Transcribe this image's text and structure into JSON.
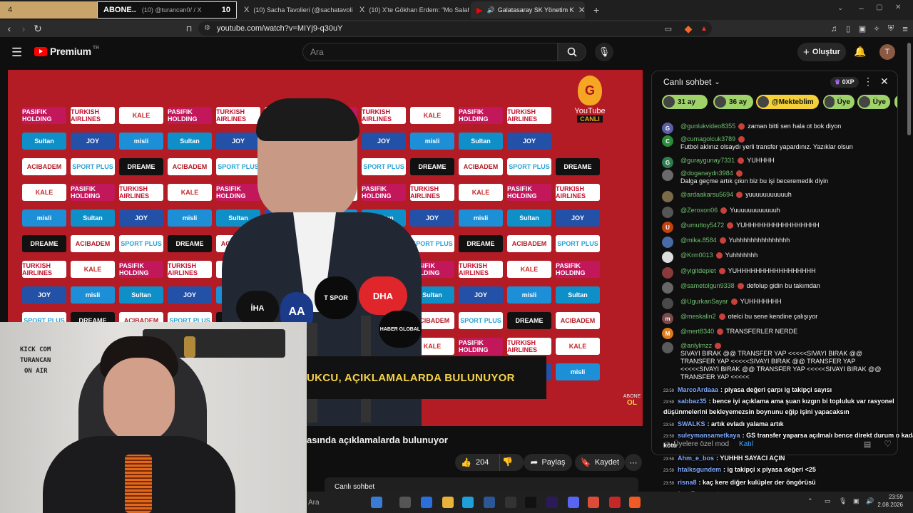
{
  "browser": {
    "tabs": [
      {
        "favicon": "4",
        "title": "ABONE.."
      },
      {
        "favicon": "",
        "title": "(10) @turancan0/ / X",
        "badge": "10"
      },
      {
        "favicon": "X",
        "title": "(10) Sacha Tavolieri (@sachatavolieri)"
      },
      {
        "favicon": "X",
        "title": "(10) X'te Gökhan Erdem: \"Mo Salah ("
      },
      {
        "favicon": "▶",
        "title": "Galatasaray SK Yönetim K"
      }
    ],
    "url": "youtube.com/watch?v=MIYj9-q30uY"
  },
  "youtube": {
    "logo_text": "Premium",
    "logo_sup": "TR",
    "search_placeholder": "Ara",
    "create_label": "Oluştur",
    "avatar_letter": "T"
  },
  "video": {
    "sponsors": [
      "PASIFIK HOLDING",
      "ACIBADEM",
      "misli",
      "TURKISH AIRLINES",
      "SPORT PLUS",
      "Sultan",
      "KALE",
      "DREAME",
      "JOY"
    ],
    "lower_third": "UKCU, AÇIKLAMALARDA BULUNUYOR",
    "channel_badge_line1": "YouTube",
    "channel_badge_line2": "CANLI",
    "corner_badge_line1": "ABONE",
    "corner_badge_line2": "OL",
    "mic_labels": [
      "İHA",
      "AA",
      "T SPOR",
      "DHA",
      "HABER GLOBAL",
      "SPOR"
    ]
  },
  "webcam": {
    "sign_lines": [
      "KICK COM",
      "TURANCAN",
      "ON AIR"
    ]
  },
  "below_video": {
    "title": "asında açıklamalarda bulunuyor",
    "like_count": "204",
    "share_label": "Paylaş",
    "save_label": "Kaydet",
    "live_chat_label": "Canlı sohbet"
  },
  "chat": {
    "title": "Canlı sohbet",
    "points": "0XP",
    "pills": [
      {
        "label": "31 ay",
        "color": "#9fd36a"
      },
      {
        "label": "36 ay",
        "color": "#9fd36a"
      },
      {
        "label": "@Mekteblim",
        "color": "#f4d13a"
      },
      {
        "label": "Üye",
        "color": "#9fd36a"
      },
      {
        "label": "Üye",
        "color": "#9fd36a"
      },
      {
        "label": "H",
        "color": "#9fd36a"
      }
    ],
    "messages": [
      {
        "initial": "G",
        "avatar_color": "#5b5fa8",
        "author": "@gunlukvideo8355",
        "text": "zaman bitti sen hala ot bok diyon"
      },
      {
        "initial": "C",
        "avatar_color": "#2e8b3a",
        "author": "@cumagolcuk3789",
        "text": "Futbol aklınız olsaydı yerli transfer yapardınız. Yazıklar olsun"
      },
      {
        "initial": "G",
        "avatar_color": "#2e7d4f",
        "author": "@guraygunay7331",
        "text": "YUHHHH"
      },
      {
        "initial": "",
        "avatar_color": "#6a6a6a",
        "author": "@doganaydn3984",
        "text": "Dalga geçme artık çıkın biz bu işi beceremedik diyin"
      },
      {
        "initial": "",
        "avatar_color": "#7a6a4a",
        "author": "@ardaakarsu5694",
        "text": "yuuuuuuuuuuuh"
      },
      {
        "initial": "",
        "avatar_color": "#555555",
        "author": "@Zeroxon06",
        "text": "Yuuuuuuuuuuuuh"
      },
      {
        "initial": "U",
        "avatar_color": "#c2410c",
        "author": "@umuttoy5472",
        "text": "YUHHHHHHHHHHHHHHHH"
      },
      {
        "initial": "",
        "avatar_color": "#4a6aa8",
        "author": "@mika.8584",
        "text": "Yuhhhhhhhhhhhhhhh"
      },
      {
        "initial": "",
        "avatar_color": "#dddddd",
        "author": "@Krm0013",
        "text": "Yuhhhhhhh"
      },
      {
        "initial": "",
        "avatar_color": "#8a3a3a",
        "author": "@yigitdepiet",
        "text": "YUHHHHHHHHHHHHHHHHH"
      },
      {
        "initial": "",
        "avatar_color": "#666666",
        "author": "@sametolgun9338",
        "text": "defolup gidin bu takımdan"
      },
      {
        "initial": "",
        "avatar_color": "#4a4a4a",
        "author": "@UgurkanSayar",
        "text": "YUHHHHHHH"
      },
      {
        "initial": "m",
        "avatar_color": "#7a4a4a",
        "author": "@meskalin2",
        "text": "otelci bu sene kendine çalışıyor"
      },
      {
        "initial": "M",
        "avatar_color": "#e07b1a",
        "author": "@mert8340",
        "text": "TRANSFERLER NERDE"
      },
      {
        "initial": "",
        "avatar_color": "#5a5a5a",
        "author": "@anlylmzz",
        "text": "SIVAYI BIRAK @@ TRANSFER YAP <<<<<SIVAYI BIRAK @@ TRANSFER YAP <<<<<SIVAYI BIRAK @@ TRANSFER YAP <<<<<SIVAYI BIRAK @@ TRANSFER YAP <<<<<SIVAYI BIRAK @@ TRANSFER YAP <<<<<"
      }
    ],
    "member_chat_label": "Üyelere özel mod",
    "join_label": "Katıl"
  },
  "overlay_chat": [
    {
      "time": "23:59",
      "name": "MarcoArdaaa",
      "text": ": piyasa değeri çarpı ig takipçi sayısı"
    },
    {
      "time": "23:59",
      "name": "sabbaz35",
      "text": ": bence iyi açıklama ama şuan kızgın bi topluluk var rasyonel"
    },
    {
      "time": "",
      "name": "",
      "text": "düşünmelerini bekleyemezsin boynunu eğip işini yapacaksın"
    },
    {
      "time": "23:59",
      "name": "SWALKS",
      "text": ": artık evladı yalama artık"
    },
    {
      "time": "23:59",
      "name": "suleymansametkaya",
      "text": ": GS transfer yaparsa açılmalı bence direkt durum o kadar"
    },
    {
      "time": "",
      "name": "",
      "text": "kötü"
    },
    {
      "time": "23:59",
      "name": "Ahm_e_bos",
      "text": ": YUHHH SAYACI AÇIN"
    },
    {
      "time": "23:59",
      "name": "htalksgundem",
      "text": ": ig takipçi x piyasa değeri <25"
    },
    {
      "time": "23:59",
      "name": "risna8",
      "text": ": kaç kere diğer kulüpler der öngörüsü"
    },
    {
      "time": "23:59",
      "name": "fen_Ege",
      "text": ": got emme sayacı"
    }
  ],
  "taskbar": {
    "search_label": "Ara",
    "time": "23:59",
    "date": "2.08.2026"
  }
}
